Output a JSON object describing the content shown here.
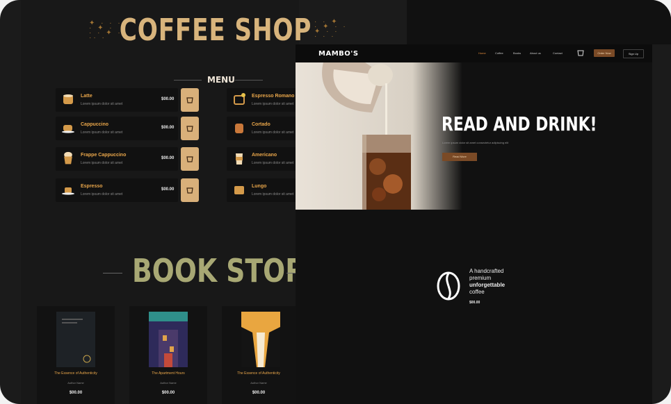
{
  "hero": {
    "title": "COFFEE SHOP"
  },
  "menu": {
    "heading": "MENU",
    "left_items": [
      {
        "name": "Latte",
        "desc": "Lorem ipsum dolor sit amet",
        "price": "$00.00"
      },
      {
        "name": "Cappuccino",
        "desc": "Lorem ipsum dolor sit amet",
        "price": "$00.00"
      },
      {
        "name": "Frappe Cappuccino",
        "desc": "Lorem ipsum dolor sit amet",
        "price": "$00.00"
      },
      {
        "name": "Espresso",
        "desc": "Lorem ipsum dolor sit amet",
        "price": "$00.00"
      }
    ],
    "right_items": [
      {
        "name": "Espresso Romano",
        "desc": "Lorem ipsum dolor sit amet"
      },
      {
        "name": "Cortado",
        "desc": "Lorem ipsum dolor sit amet"
      },
      {
        "name": "Americano",
        "desc": "Lorem ipsum dolor sit amet"
      },
      {
        "name": "Lungo",
        "desc": "Lorem ipsum dolor sit amet"
      }
    ]
  },
  "books": {
    "heading": "BOOK STORE",
    "items": [
      {
        "title": "The Essence of Authenticity",
        "author": "Author Name",
        "price": "$00.00"
      },
      {
        "title": "The Apartment Hours",
        "author": "Author Name",
        "price": "$00.00"
      },
      {
        "title": "The Essence of Authenticity",
        "author": "Author Name",
        "price": "$00.00"
      }
    ]
  },
  "site": {
    "logo": "MAMBO'S",
    "nav": [
      "Home",
      "Coffee",
      "Books",
      "About us",
      "Contact"
    ],
    "nav_button_primary": "Order Now",
    "nav_button_secondary": "Sign Up",
    "hero_heading": "READ AND DRINK!",
    "hero_sub": "Lorem ipsum dolor sit amet consectetur adipiscing elit",
    "hero_button": "Read More",
    "feature_lines": [
      "A handcrafted",
      "premium",
      "unforgettable",
      "coffee"
    ],
    "feature_price": "$00.00"
  },
  "colors": {
    "accent": "#d9b07a",
    "menu_text": "#e9a64a",
    "book_heading": "#a8a874",
    "cta": "#7a4a26"
  }
}
